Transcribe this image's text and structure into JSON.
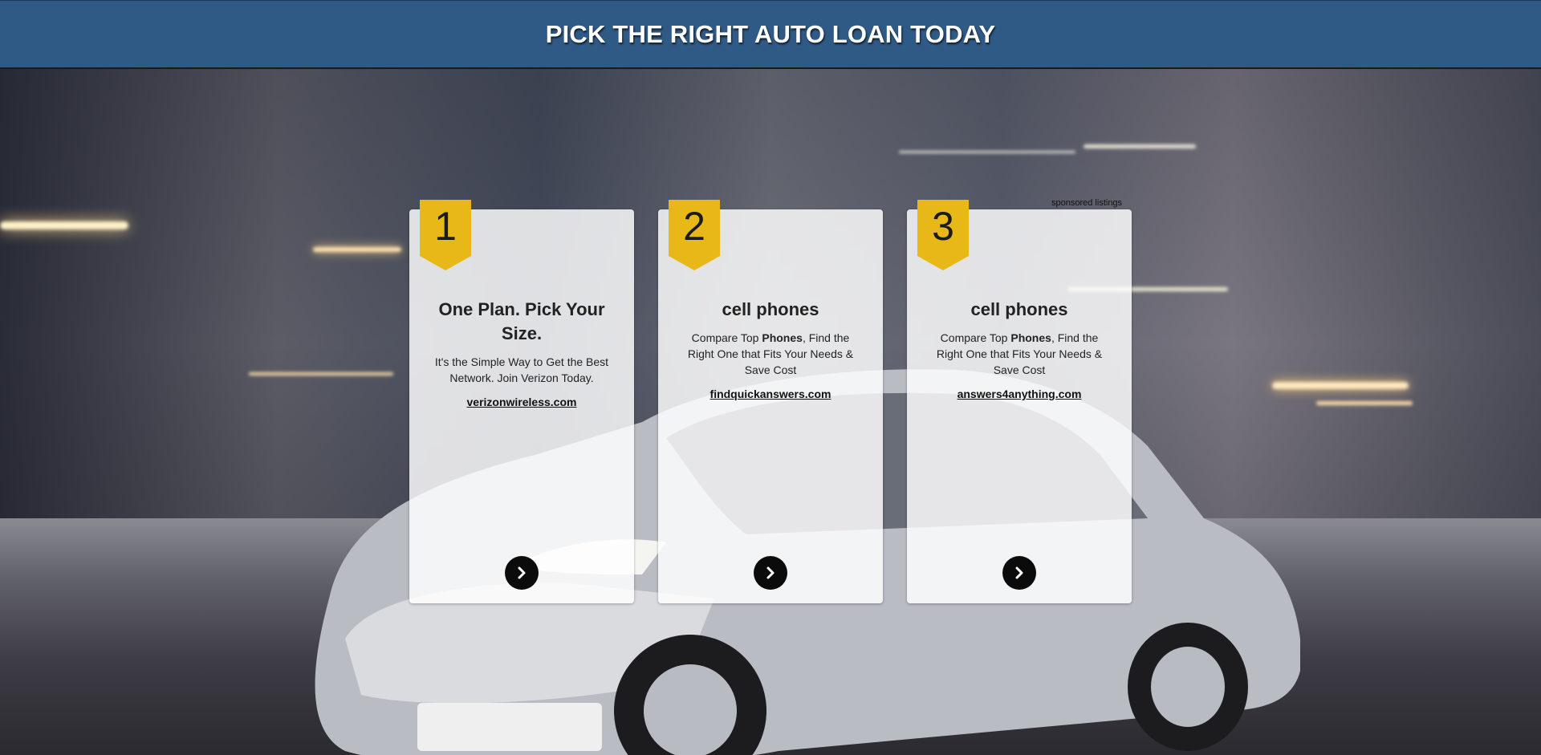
{
  "header": {
    "title": "PICK THE RIGHT AUTO LOAN TODAY"
  },
  "sponsored_label": "sponsored listings",
  "colors": {
    "header_bg": "#305a86",
    "ribbon": "#e8b818",
    "arrow_button": "#0b0b0b"
  },
  "cards": [
    {
      "rank": "1",
      "title": "One Plan. Pick Your Size.",
      "desc_pre": "It's the Simple Way to Get the Best Network. Join Verizon Today.",
      "desc_bold": "",
      "desc_post": "",
      "link": "verizonwireless.com",
      "arrow_icon": "chevron-right-icon"
    },
    {
      "rank": "2",
      "title": "cell phones",
      "desc_pre": "Compare Top ",
      "desc_bold": "Phones",
      "desc_post": ", Find the Right One that Fits Your Needs & Save Cost",
      "link": "findquickanswers.com",
      "arrow_icon": "chevron-right-icon"
    },
    {
      "rank": "3",
      "title": "cell phones",
      "desc_pre": "Compare Top ",
      "desc_bold": "Phones",
      "desc_post": ", Find the Right One that Fits Your Needs & Save Cost",
      "link": "answers4anything.com",
      "arrow_icon": "chevron-right-icon"
    }
  ]
}
